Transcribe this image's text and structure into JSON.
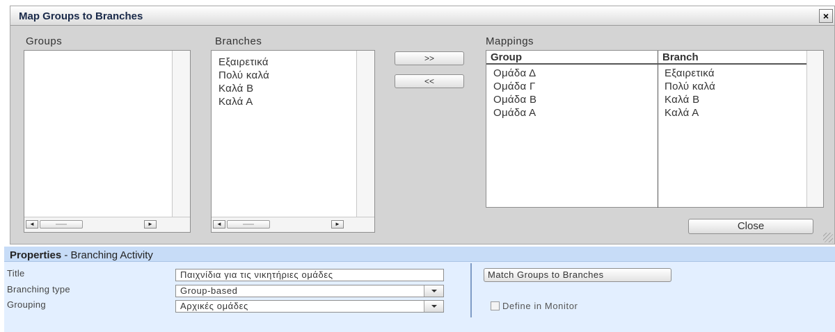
{
  "dialog": {
    "title": "Map Groups to Branches",
    "close_icon": "×",
    "groups_label": "Groups",
    "branches_label": "Branches",
    "mappings_label": "Mappings",
    "groups": [],
    "branches": [
      "Εξαιρετικά",
      "Πολύ καλά",
      "Καλά Β",
      "Καλά Α"
    ],
    "add_button": ">>",
    "remove_button": "<<",
    "mappings": {
      "headers": [
        "Group",
        "Branch"
      ],
      "rows": [
        {
          "group": "Ομάδα Δ",
          "branch": "Εξαιρετικά"
        },
        {
          "group": "Ομάδα Γ",
          "branch": "Πολύ καλά"
        },
        {
          "group": "Ομάδα Β",
          "branch": "Καλά Β"
        },
        {
          "group": "Ομάδα Α",
          "branch": "Καλά Α"
        }
      ]
    },
    "close_button": "Close",
    "scroll_left": "◄",
    "scroll_right": "►"
  },
  "properties": {
    "title_bold": "Properties",
    "title_rest": " - Branching Activity",
    "title_label": "Title",
    "title_value": "Παιχνίδια για τις νικητήριες ομάδες",
    "branching_type_label": "Branching type",
    "branching_type_value": "Group-based",
    "grouping_label": "Grouping",
    "grouping_value": "Αρχικές ομάδες",
    "match_button": "Match Groups to Branches",
    "define_in_monitor_label": "Define in Monitor",
    "define_in_monitor_checked": false
  },
  "colors": {
    "dialog_bg": "#d4d4d4",
    "properties_bg": "#e3efff",
    "properties_header_bg": "#c7dcf7"
  }
}
